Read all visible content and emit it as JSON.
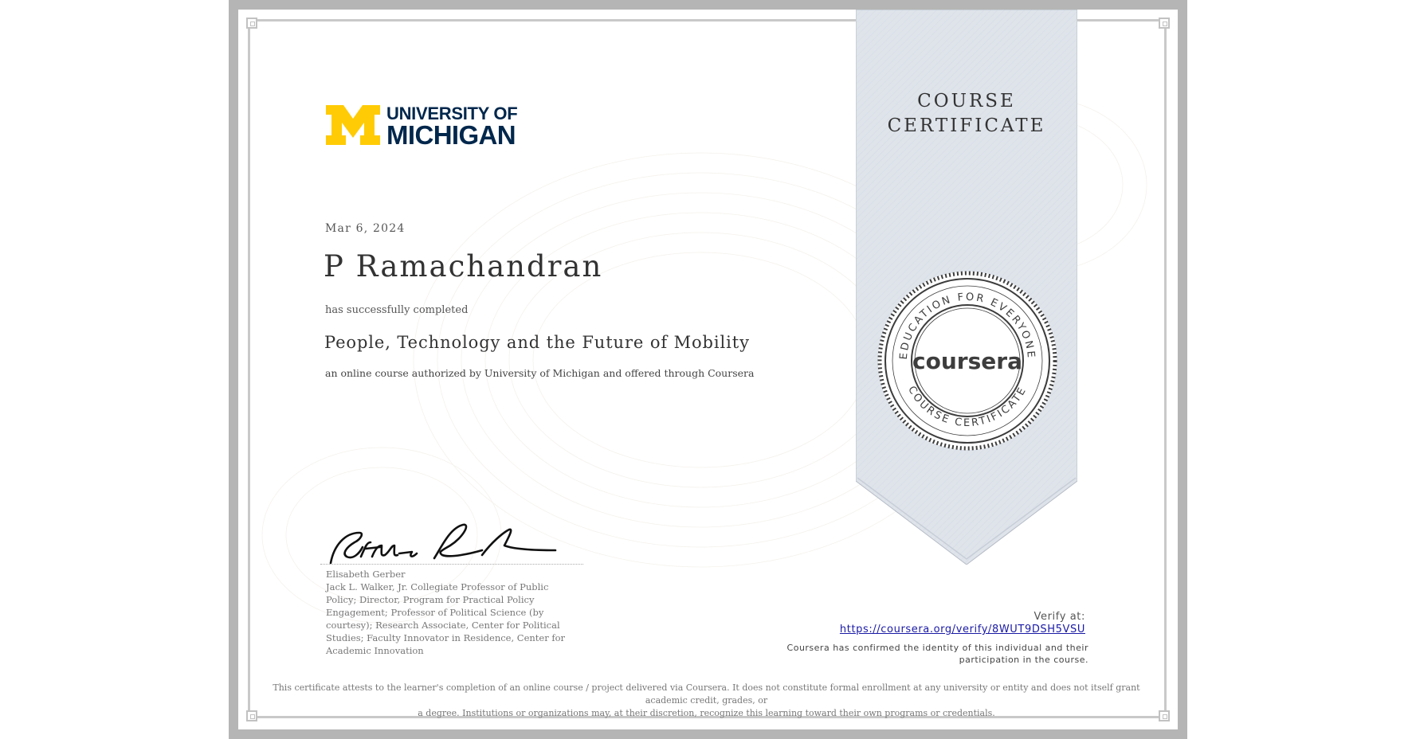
{
  "certificate": {
    "university_logo": {
      "line1": "UNIVERSITY OF",
      "line2": "MICHIGAN",
      "colors": {
        "maize": "#ffcb05",
        "blue": "#00274c"
      }
    },
    "date": "Mar 6, 2024",
    "recipient_name": "P Ramachandran",
    "completion_text": "has successfully completed",
    "course_title": "People, Technology and the Future of Mobility",
    "authorization_text": "an online course authorized by University of Michigan and offered through Coursera",
    "ribbon": {
      "line1": "COURSE",
      "line2": "CERTIFICATE",
      "color": "#dfe4eb"
    },
    "seal": {
      "wordmark": "coursera",
      "arc_top": "EDUCATION FOR EVERYONE",
      "arc_bottom": "COURSE CERTIFICATE"
    },
    "signer": {
      "name": "Elisabeth Gerber",
      "title": "Jack L. Walker, Jr. Collegiate Professor of Public Policy; Director, Program for Practical Policy Engagement; Professor of Political Science (by courtesy); Research Associate, Center for Political Studies; Faculty Innovator in Residence, Center for Academic Innovation"
    },
    "verify": {
      "label": "Verify at:",
      "url": "https://coursera.org/verify/8WUT9DSH5VSU",
      "identity_line1": "Coursera has confirmed the identity of this individual and their",
      "identity_line2": "participation in the course."
    },
    "disclaimer_line1": "This certificate attests to the learner's completion of an online course / project delivered via Coursera. It does not constitute formal enrollment at any university or entity and does not itself grant academic credit, grades, or",
    "disclaimer_line2": "a degree. Institutions or organizations may, at their discretion, recognize this learning toward their own programs or credentials."
  }
}
